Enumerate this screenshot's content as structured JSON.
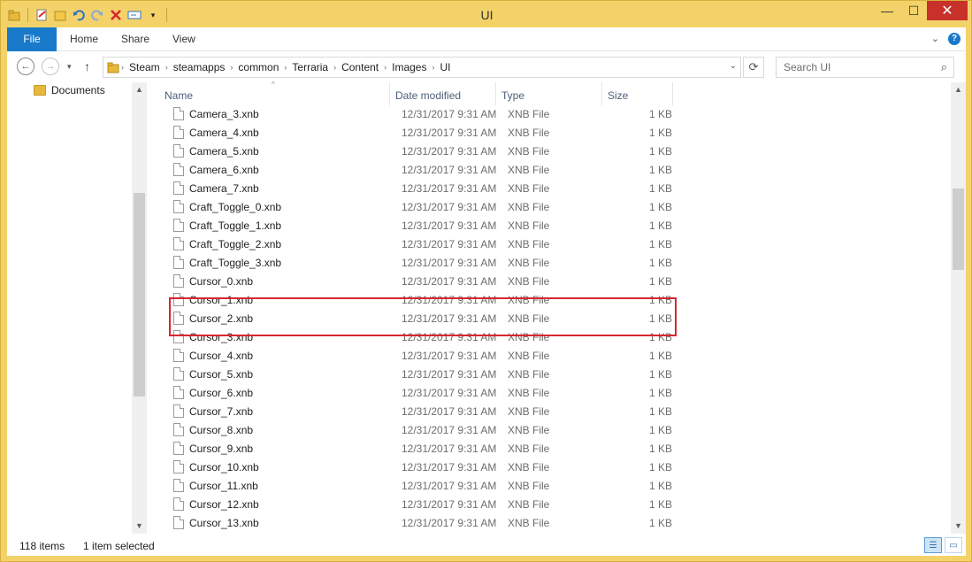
{
  "window": {
    "title": "UI"
  },
  "quick_access": {
    "icons": [
      "folder-icon",
      "properties-icon",
      "new-folder-icon",
      "undo-icon",
      "redo-icon",
      "delete-icon",
      "rename-icon",
      "customize-dropdown-icon"
    ]
  },
  "window_controls": {
    "minimize": "—",
    "maximize": "☐",
    "close": "✕"
  },
  "ribbon": {
    "tabs": [
      "File",
      "Home",
      "Share",
      "View"
    ],
    "expand_glyph": "⌄",
    "help_glyph": "?"
  },
  "address": {
    "back_glyph": "←",
    "forward_glyph": "→",
    "up_glyph": "↑",
    "breadcrumbs": [
      "Steam",
      "steamapps",
      "common",
      "Terraria",
      "Content",
      "Images",
      "UI"
    ],
    "search_placeholder": "Search UI"
  },
  "nav_pane": {
    "items": [
      {
        "label": "Documents"
      }
    ]
  },
  "columns": {
    "name": "Name",
    "date": "Date modified",
    "type": "Type",
    "size": "Size"
  },
  "files": [
    {
      "name": "Camera_3.xnb",
      "date": "12/31/2017 9:31 AM",
      "type": "XNB File",
      "size": "1 KB"
    },
    {
      "name": "Camera_4.xnb",
      "date": "12/31/2017 9:31 AM",
      "type": "XNB File",
      "size": "1 KB"
    },
    {
      "name": "Camera_5.xnb",
      "date": "12/31/2017 9:31 AM",
      "type": "XNB File",
      "size": "1 KB"
    },
    {
      "name": "Camera_6.xnb",
      "date": "12/31/2017 9:31 AM",
      "type": "XNB File",
      "size": "1 KB"
    },
    {
      "name": "Camera_7.xnb",
      "date": "12/31/2017 9:31 AM",
      "type": "XNB File",
      "size": "1 KB"
    },
    {
      "name": "Craft_Toggle_0.xnb",
      "date": "12/31/2017 9:31 AM",
      "type": "XNB File",
      "size": "1 KB"
    },
    {
      "name": "Craft_Toggle_1.xnb",
      "date": "12/31/2017 9:31 AM",
      "type": "XNB File",
      "size": "1 KB"
    },
    {
      "name": "Craft_Toggle_2.xnb",
      "date": "12/31/2017 9:31 AM",
      "type": "XNB File",
      "size": "1 KB"
    },
    {
      "name": "Craft_Toggle_3.xnb",
      "date": "12/31/2017 9:31 AM",
      "type": "XNB File",
      "size": "1 KB"
    },
    {
      "name": "Cursor_0.xnb",
      "date": "12/31/2017 9:31 AM",
      "type": "XNB File",
      "size": "1 KB"
    },
    {
      "name": "Cursor_1.xnb",
      "date": "12/31/2017 9:31 AM",
      "type": "XNB File",
      "size": "1 KB"
    },
    {
      "name": "Cursor_2.xnb",
      "date": "12/31/2017 9:31 AM",
      "type": "XNB File",
      "size": "1 KB"
    },
    {
      "name": "Cursor_3.xnb",
      "date": "12/31/2017 9:31 AM",
      "type": "XNB File",
      "size": "1 KB"
    },
    {
      "name": "Cursor_4.xnb",
      "date": "12/31/2017 9:31 AM",
      "type": "XNB File",
      "size": "1 KB"
    },
    {
      "name": "Cursor_5.xnb",
      "date": "12/31/2017 9:31 AM",
      "type": "XNB File",
      "size": "1 KB"
    },
    {
      "name": "Cursor_6.xnb",
      "date": "12/31/2017 9:31 AM",
      "type": "XNB File",
      "size": "1 KB"
    },
    {
      "name": "Cursor_7.xnb",
      "date": "12/31/2017 9:31 AM",
      "type": "XNB File",
      "size": "1 KB"
    },
    {
      "name": "Cursor_8.xnb",
      "date": "12/31/2017 9:31 AM",
      "type": "XNB File",
      "size": "1 KB"
    },
    {
      "name": "Cursor_9.xnb",
      "date": "12/31/2017 9:31 AM",
      "type": "XNB File",
      "size": "1 KB"
    },
    {
      "name": "Cursor_10.xnb",
      "date": "12/31/2017 9:31 AM",
      "type": "XNB File",
      "size": "1 KB"
    },
    {
      "name": "Cursor_11.xnb",
      "date": "12/31/2017 9:31 AM",
      "type": "XNB File",
      "size": "1 KB"
    },
    {
      "name": "Cursor_12.xnb",
      "date": "12/31/2017 9:31 AM",
      "type": "XNB File",
      "size": "1 KB"
    },
    {
      "name": "Cursor_13.xnb",
      "date": "12/31/2017 9:31 AM",
      "type": "XNB File",
      "size": "1 KB"
    }
  ],
  "status": {
    "item_count": "118 items",
    "selection": "1 item selected"
  },
  "colors": {
    "accent": "#1979ca",
    "frame": "#f3d26a",
    "highlight_box": "#d8262f"
  }
}
